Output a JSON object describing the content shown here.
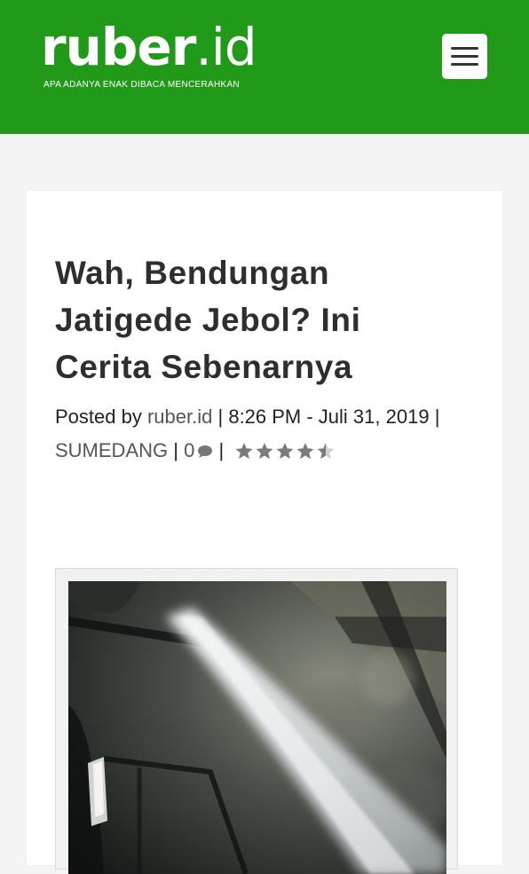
{
  "header": {
    "logo_text_main": "ruber",
    "logo_text_suffix": ".id",
    "tagline": "APA ADANYA ENAK DIBACA MENCERAHKAN",
    "menu_icon": "hamburger-menu-icon",
    "bg_color": "#219a19"
  },
  "article": {
    "title": "Wah, Bendungan Jatigede Jebol? Ini Cerita Sebenarnya",
    "meta": {
      "posted_by_label": "Posted by",
      "author": "ruber.id",
      "time_date": "8:26 PM - Juli 31, 2019",
      "category": "SUMEDANG",
      "comment_count": "0",
      "comment_icon": "comment-bubble-icon",
      "rating": 4.5,
      "rating_max": 5,
      "separator": "|"
    },
    "image": {
      "subject": "water-leak-photo"
    }
  }
}
